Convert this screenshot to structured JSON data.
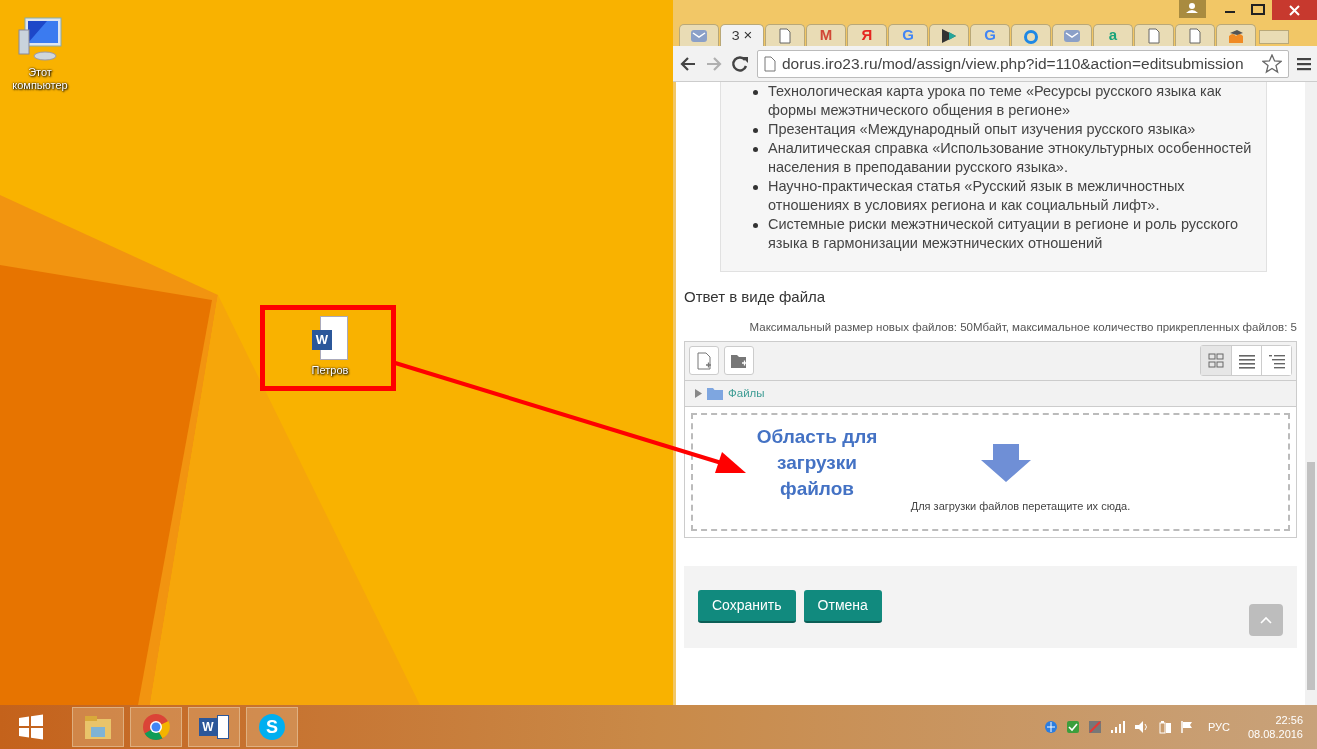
{
  "desktop": {
    "icons": [
      {
        "kind": "computer",
        "label": "Этот компьютер",
        "highlighted": false
      },
      {
        "kind": "document",
        "glyph": "W",
        "label": "Петров",
        "highlighted": true
      }
    ]
  },
  "annotation": {
    "text": "Область для загрузки файлов"
  },
  "browser": {
    "tabs": [
      {
        "kind": "envelope",
        "selected": false
      },
      {
        "kind": "text",
        "label": "З",
        "close": "×",
        "selected": true
      },
      {
        "kind": "page",
        "selected": false
      },
      {
        "kind": "glyph",
        "glyph": "M",
        "color": "#d14836",
        "selected": false
      },
      {
        "kind": "glyph",
        "glyph": "Я",
        "color": "#e52620",
        "selected": false
      },
      {
        "kind": "glyph",
        "glyph": "G",
        "color": "#4285f4",
        "selected": false
      },
      {
        "kind": "play",
        "selected": false
      },
      {
        "kind": "glyph",
        "glyph": "G",
        "color": "#4285f4",
        "selected": false
      },
      {
        "kind": "ring",
        "selected": false
      },
      {
        "kind": "envelope",
        "selected": false
      },
      {
        "kind": "glyph",
        "glyph": "a",
        "color": "#1aa37a",
        "selected": false
      },
      {
        "kind": "page",
        "selected": false
      },
      {
        "kind": "page",
        "selected": false
      },
      {
        "kind": "hat",
        "selected": false
      }
    ],
    "url": "dorus.iro23.ru/mod/assign/view.php?id=110&action=editsubmission"
  },
  "page": {
    "bullets": [
      "Технологическая карта урока по теме «Ресурсы русского языка как формы межэтнического общения в регионе»",
      "Презентация «Международный опыт изучения русского языка»",
      "Аналитическая справка «Использование этнокультурных особенностей населения в преподавании русского языка».",
      "Научно-практическая статья «Русский язык в межличностных отношениях в условиях региона и как социальный лифт».",
      "Системные риски межэтнической ситуации в регионе и роль русского языка в гармонизации межэтнических отношений"
    ],
    "section_title": "Ответ в виде файла",
    "limits": "Максимальный размер новых файлов: 50Мбайт, максимальное количество прикрепленных файлов: 5",
    "view_modes": [
      {
        "kind": "icons",
        "selected": true
      },
      {
        "kind": "list",
        "selected": false
      },
      {
        "kind": "tree",
        "selected": false
      }
    ],
    "path": "Файлы",
    "drop_hint": "Для загрузки файлов перетащите их сюда.",
    "buttons": [
      "Сохранить",
      "Отмена"
    ]
  },
  "taskbar": {
    "apps": [
      {
        "kind": "explorer"
      },
      {
        "kind": "chrome"
      },
      {
        "kind": "word",
        "glyph": "W"
      },
      {
        "kind": "skype",
        "glyph": "S"
      }
    ],
    "language": "РУС",
    "time": "22:56",
    "date": "08.08.2016"
  }
}
